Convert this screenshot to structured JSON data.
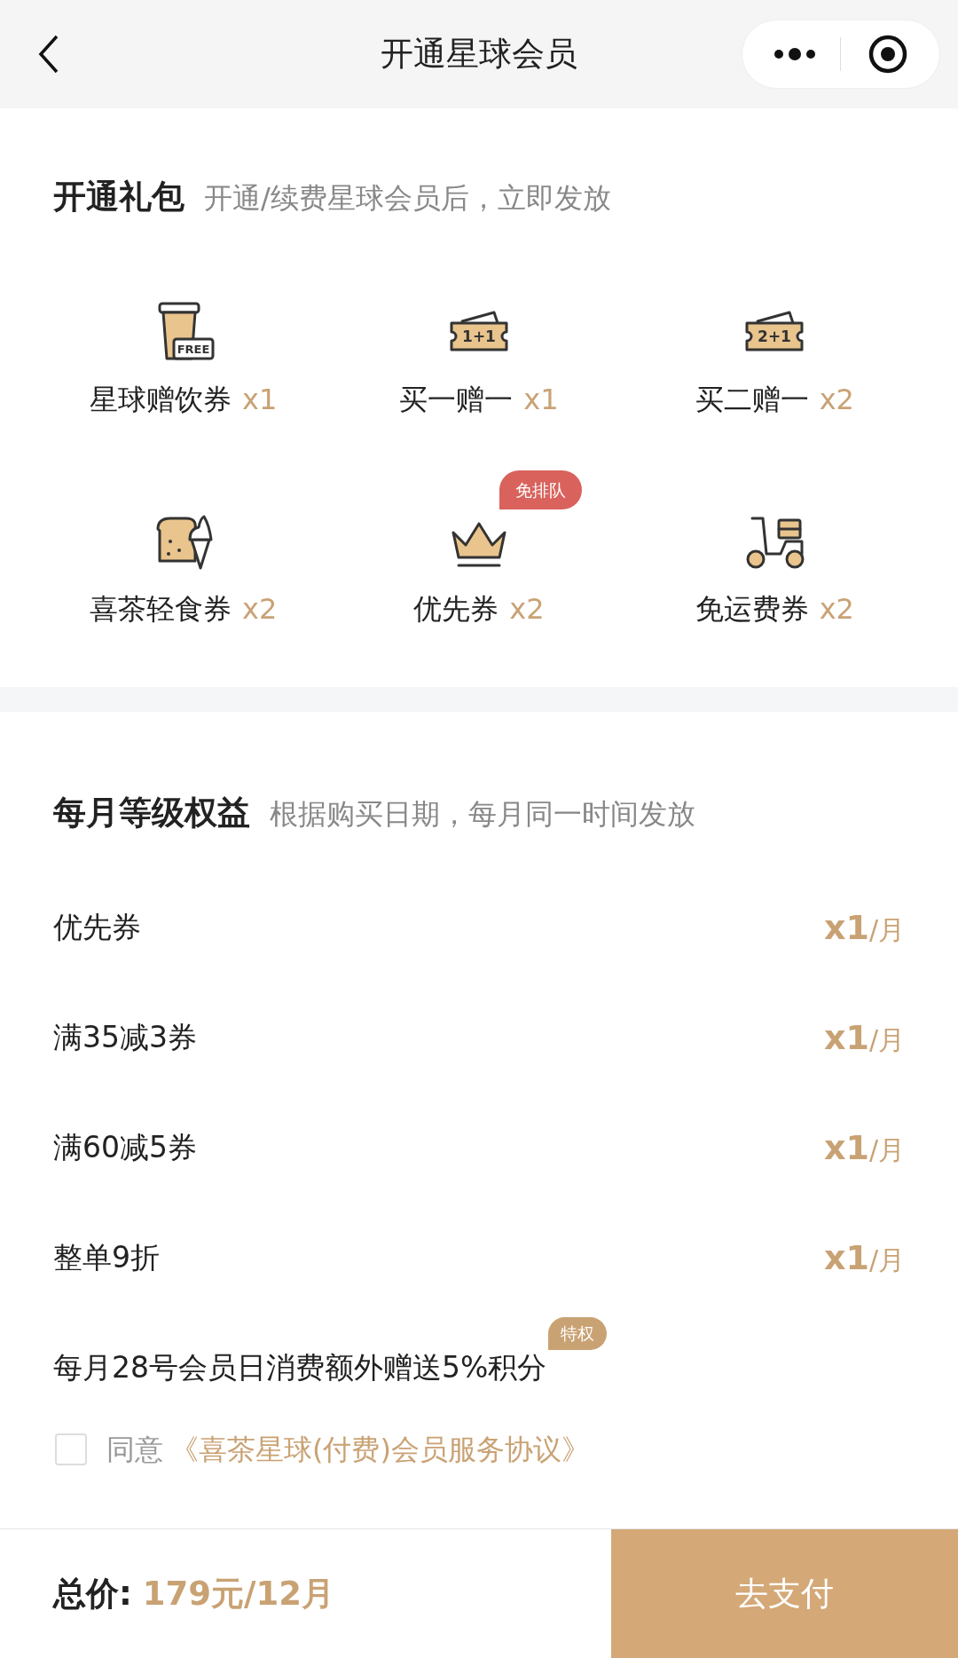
{
  "nav": {
    "title": "开通星球会员"
  },
  "gift_pack": {
    "title": "开通礼包",
    "subtitle": "开通/续费星球会员后，立即发放",
    "items": [
      {
        "kind": "cup",
        "icon_text": "FREE",
        "label": "星球赠饮券",
        "count": "x1"
      },
      {
        "kind": "ticket",
        "icon_text": "1+1",
        "label": "买一赠一",
        "count": "x1"
      },
      {
        "kind": "ticket",
        "icon_text": "2+1",
        "label": "买二赠一",
        "count": "x2"
      },
      {
        "kind": "food",
        "label": "喜茶轻食券",
        "count": "x2"
      },
      {
        "kind": "crown",
        "label": "优先券",
        "count": "x2",
        "badge": "免排队"
      },
      {
        "kind": "scooter",
        "label": "免运费券",
        "count": "x2"
      }
    ]
  },
  "monthly": {
    "title": "每月等级权益",
    "subtitle": "根据购买日期，每月同一时间发放",
    "rows": [
      {
        "kind": "count",
        "label": "优先券",
        "count": "x1",
        "unit": "/月"
      },
      {
        "kind": "count",
        "label": "满35减3券",
        "count": "x1",
        "unit": "/月"
      },
      {
        "kind": "count",
        "label": "满60减5券",
        "count": "x1",
        "unit": "/月"
      },
      {
        "kind": "count",
        "label": "整单9折",
        "count": "x1",
        "unit": "/月"
      },
      {
        "kind": "badge",
        "label": "每月28号会员日消费额外赠送5%积分",
        "badge": "特权"
      }
    ]
  },
  "agreement": {
    "checked": false,
    "prefix": "同意",
    "link": "《喜茶星球(付费)会员服务协议》"
  },
  "footer": {
    "total_label": "总价:",
    "total_value": "179元/12月",
    "pay_button": "去支付"
  }
}
